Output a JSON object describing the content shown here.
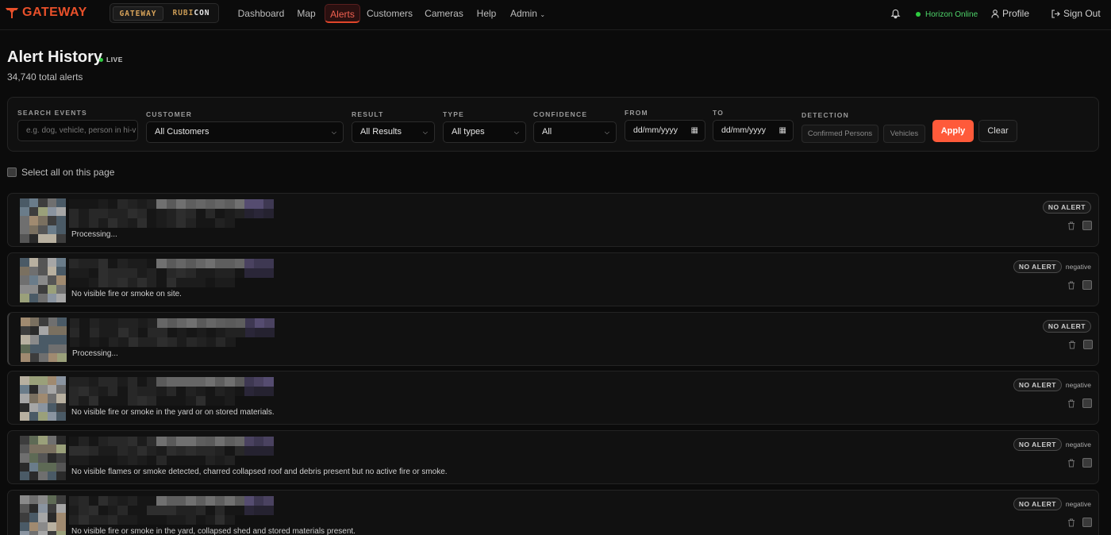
{
  "nav": {
    "logo": "GATEWAY",
    "brands": {
      "gateway": "GATEWAY",
      "rubicon_prefix": "RUBI",
      "rubicon_suffix": "CON"
    },
    "links": [
      "Dashboard",
      "Map",
      "Alerts",
      "Customers",
      "Cameras",
      "Help",
      "Admin"
    ],
    "active": "Alerts",
    "status": "Horizon Online",
    "profile": "Profile",
    "signout": "Sign Out"
  },
  "header": {
    "title": "Alert History",
    "live": "LIVE",
    "total": "34,740 total alerts"
  },
  "filters": {
    "search_label": "SEARCH EVENTS",
    "search_placeholder": "e.g. dog, vehicle, person in hi-v",
    "customer_label": "CUSTOMER",
    "customer_value": "All Customers",
    "result_label": "RESULT",
    "result_value": "All Results",
    "type_label": "TYPE",
    "type_value": "All types",
    "confidence_label": "CONFIDENCE",
    "confidence_value": "All",
    "from_label": "FROM",
    "from_value": "dd/mm/yyyy",
    "to_label": "TO",
    "to_value": "dd/mm/yyyy",
    "detection_label": "DETECTION",
    "detection_options": [
      "Confirmed Persons",
      "Vehicles"
    ],
    "apply": "Apply",
    "clear": "Clear"
  },
  "select_all": "Select all on this page",
  "alerts": [
    {
      "badge": "NO ALERT",
      "result": "",
      "summary": "Processing..."
    },
    {
      "badge": "NO ALERT",
      "result": "negative",
      "summary": "No visible fire or smoke on site."
    },
    {
      "badge": "NO ALERT",
      "result": "",
      "summary": "Processing..."
    },
    {
      "badge": "NO ALERT",
      "result": "negative",
      "summary": "No visible fire or smoke in the yard or on stored materials."
    },
    {
      "badge": "NO ALERT",
      "result": "negative",
      "summary": "No visible flames or smoke detected, charred collapsed roof and debris present but no active fire or smoke."
    },
    {
      "badge": "NO ALERT",
      "result": "negative",
      "summary": "No visible fire or smoke in the yard, collapsed shed and stored materials present."
    }
  ],
  "colors": {
    "accent": "#ff5a3a",
    "online": "#2ecc40",
    "active_nav": "#e0452a"
  },
  "icons": {
    "logo": "flame-y-icon",
    "bell": "bell-icon",
    "profile": "person-icon",
    "signout": "sign-out-icon",
    "trash": "trash-icon",
    "calendar": "calendar-icon",
    "chevron": "chevron-down-icon"
  }
}
